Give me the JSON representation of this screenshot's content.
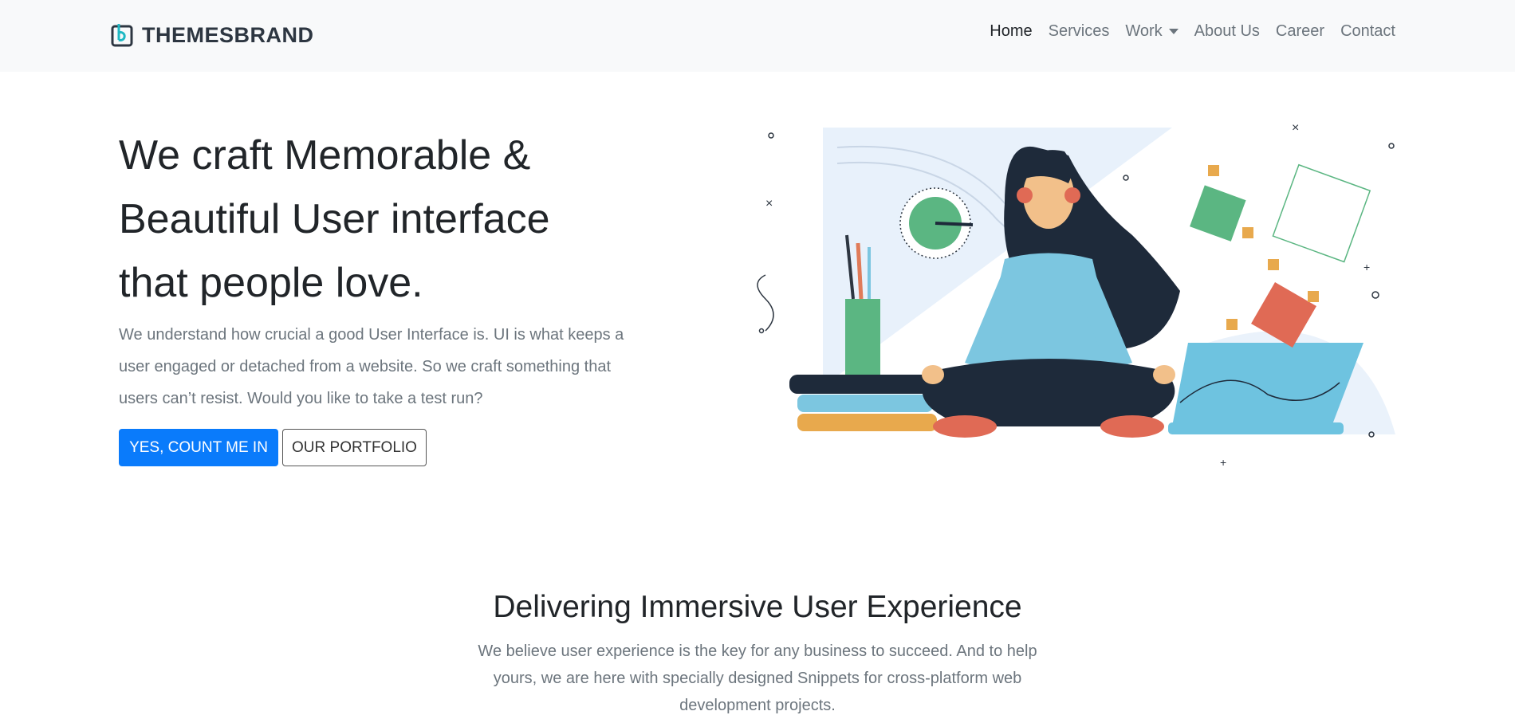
{
  "brand": {
    "name": "THEMESBRAND",
    "logo_icon": "b-square-logo-icon"
  },
  "nav": {
    "items": [
      {
        "label": "Home",
        "active": true
      },
      {
        "label": "Services"
      },
      {
        "label": "Work",
        "dropdown": true
      },
      {
        "label": "About Us"
      },
      {
        "label": "Career"
      },
      {
        "label": "Contact"
      }
    ]
  },
  "hero": {
    "title_line1": "We craft Memorable &",
    "title_line2": "Beautiful User interface",
    "title_line3": "that people love.",
    "description": "We understand how crucial a good User Interface is. UI is what keeps a user engaged or detached from a website. So we craft something that users can’t resist. Would you like to take a test run?",
    "primary_button": "YES, COUNT ME IN",
    "secondary_button": "OUR PORTFOLIO",
    "illustration": "meditating-woman-illustration"
  },
  "section": {
    "title": "Delivering Immersive User Experience",
    "description": "We believe user experience is the key for any business to succeed. And to help yours, we are here with specially designed Snippets for cross-platform web development projects."
  },
  "colors": {
    "primary": "#0a7bfb",
    "navbar_bg": "#f8f9fa",
    "muted_text": "#6c757d",
    "brand_accent": "#1fb8c3"
  }
}
